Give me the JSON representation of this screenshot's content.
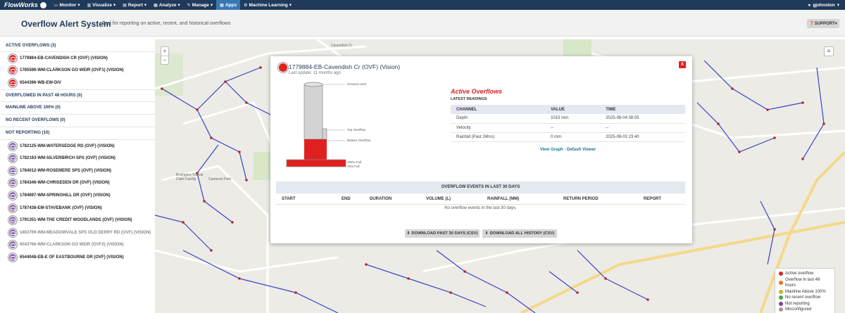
{
  "navbar": {
    "brand": "FlowWorks",
    "items": [
      {
        "label": "Monitor",
        "icon": "monitor-icon"
      },
      {
        "label": "Visualize",
        "icon": "chart-icon"
      },
      {
        "label": "Report",
        "icon": "report-icon"
      },
      {
        "label": "Analyze",
        "icon": "analyze-icon"
      },
      {
        "label": "Manage",
        "icon": "wrench-icon"
      },
      {
        "label": "Apps",
        "icon": "grid-icon",
        "active": true
      },
      {
        "label": "Machine Learning",
        "icon": "gear-icon"
      }
    ],
    "user": "gjohnston"
  },
  "header": {
    "title": "Overflow Alert System",
    "subtitle": "Tool for reporting on active, recent, and historical overflows",
    "support": "SUPPORT"
  },
  "sidebar": {
    "active_head": "ACTIVE OVERFLOWS (3)",
    "active_sites": [
      {
        "label": "1779884-EB-CAVENDISH CR (OVF) (VISION)",
        "color": "red"
      },
      {
        "label": "1785596-WM-CLARKSON GO WEIR (OVF1) (VISION)",
        "color": "red"
      },
      {
        "label": "6544396-WB-EW-DIV",
        "color": "red"
      }
    ],
    "past48_head": "OVERFLOWED IN PAST 48 HOURS (0)",
    "mainline_head": "MAINLINE ABOVE 100% (0)",
    "norecent_head": "NO RECENT OVERFLOWS (0)",
    "notreporting_head": "NOT REPORTING (10)",
    "notreporting_sites": [
      {
        "label": "1782125-WM-WATERSEDGE RD (OVF) (VISION)",
        "muted": false
      },
      {
        "label": "1782193-WM-SILVERBIRCH SPS (OVF) (VISION)",
        "muted": false
      },
      {
        "label": "1784012-WM-ROSEMERE SPS (OVF) (VISION)",
        "muted": false
      },
      {
        "label": "1784346-WM-CHRISEDEN DR (OVF) (VISION)",
        "muted": false
      },
      {
        "label": "1784697-WM-SPRINGHILL DR (OVF) (VISION)",
        "muted": false
      },
      {
        "label": "1787438-EM-STAVEBANK (OVF) (VISION)",
        "muted": false
      },
      {
        "label": "1791351-WM-THE CREDIT WOODLANDS (OVF) (VISION)",
        "muted": false
      },
      {
        "label": "1802769-WM-MEADOWVALE SPS OLD DERRY RD (OVF) (VISION)",
        "muted": true
      },
      {
        "label": "6543766-WM-CLARKSON GO WEIR (OVF2) (VISION)",
        "muted": true
      },
      {
        "label": "6544048-EB-E OF EASTBOURNE DR (OVF) (VISION)",
        "muted": false
      }
    ]
  },
  "map": {
    "zoom_in": "+",
    "zoom_out": "−",
    "labels": {
      "cavendish": "Cavendish Cr",
      "transit": "Brampton Transit Clark Facility",
      "park": "Cameron Park"
    }
  },
  "legend": [
    {
      "label": "Active overflow",
      "color": "#d62b1f"
    },
    {
      "label": "Overflow in last 48 hours",
      "color": "#e8761f"
    },
    {
      "label": "Mainline Above 100%",
      "color": "#d4b21c"
    },
    {
      "label": "No recent overflow",
      "color": "#3fae49"
    },
    {
      "label": "Not reporting",
      "color": "#7e3fa0"
    },
    {
      "label": "Misconfigured",
      "color": "#9a9a9a"
    }
  ],
  "popup": {
    "title": "1779884-EB-Cavendish Cr (OVF) (Vision)",
    "last_update": "Last update: 11 months ago",
    "close": "X",
    "diagram": {
      "ground": "Ground Level",
      "top_overflow": "Top Overflow",
      "bottom_overflow": "Bottom Overflow",
      "full100": "100% Full",
      "full75": "75% Full"
    },
    "active_title": "Active Overflows",
    "latest_label": "LATEST READINGS",
    "readings_cols": [
      "CHANNEL",
      "VALUE",
      "TIME"
    ],
    "readings": [
      {
        "channel": "Depth",
        "value": "1015 mm",
        "time": "2025-08-04 08:05"
      },
      {
        "channel": "Velocity",
        "value": "--",
        "time": "--"
      },
      {
        "channel": "Rainfall (Past 24hrs)",
        "value": "0 mm",
        "time": "2025-08-03 23:40"
      }
    ],
    "view_graph": "View Graph - Default Viewer",
    "events_head": "OVERFLOW EVENTS IN LAST 30 DAYS",
    "events_cols": [
      "START",
      "END",
      "DURATION",
      "VOLUME (L)",
      "RAINFALL (MM)",
      "RETURN PERIOD",
      "REPORT"
    ],
    "no_events": "No overflow events in the last 30 days.",
    "download_30": "DOWNLOAD PAST 30 DAYS (CSV)",
    "download_all": "DOWNLOAD ALL HISTORY (CSV)"
  }
}
